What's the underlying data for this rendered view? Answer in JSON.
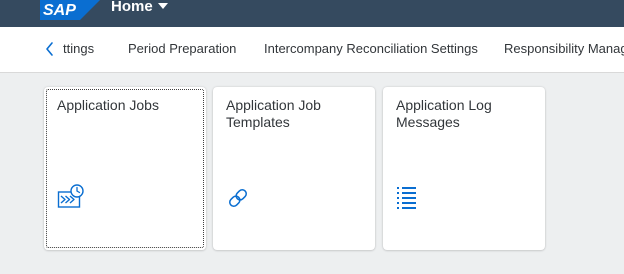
{
  "shell": {
    "logo_text": "SAP",
    "title": "Home",
    "bar_color": "#354a5f",
    "logo_color": "#0a6ed1"
  },
  "anchor_bar": {
    "back_icon": "chevron-left-icon",
    "items": [
      {
        "label": "ttings"
      },
      {
        "label": "Period Preparation"
      },
      {
        "label": "Intercompany Reconciliation Settings"
      },
      {
        "label": "Responsibility Manag"
      }
    ]
  },
  "tiles": [
    {
      "title": "Application Jobs",
      "icon": "application-jobs-icon"
    },
    {
      "title": "Application Job Templates",
      "icon": "chain-link-icon"
    },
    {
      "title": "Application Log Messages",
      "icon": "list-icon"
    }
  ],
  "accent_color": "#0a6ed1"
}
